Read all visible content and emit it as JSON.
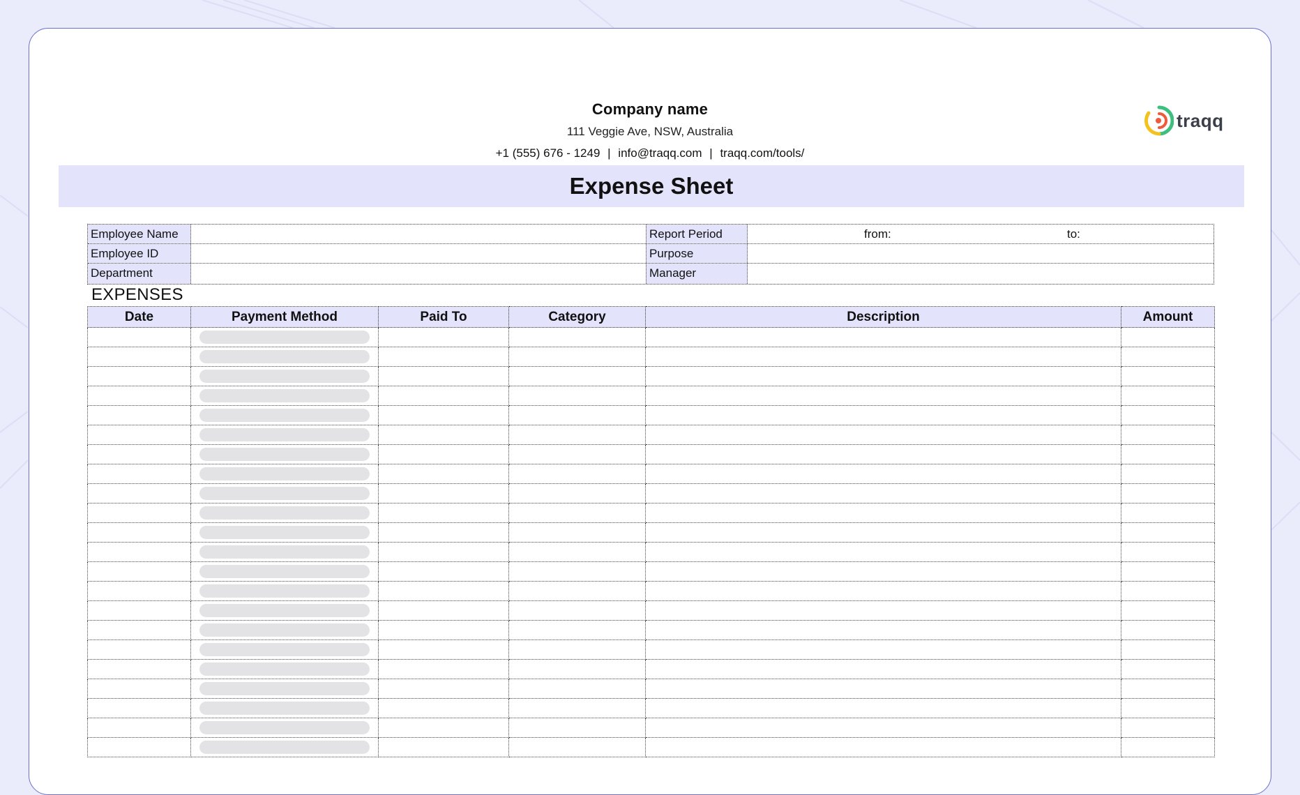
{
  "header": {
    "company_name": "Company name",
    "address": "111 Veggie Ave, NSW, Australia",
    "phone": "+1 (555) 676 - 1249",
    "email": "info@traqq.com",
    "website": "traqq.com/tools/",
    "separator": "|",
    "logo_text": "traqq",
    "logo_icon": "traqq-logo-icon"
  },
  "title": "Expense Sheet",
  "info": {
    "employee_name_label": "Employee Name",
    "employee_id_label": "Employee ID",
    "department_label": "Department",
    "report_period_label": "Report Period",
    "from_label": "from:",
    "to_label": "to:",
    "purpose_label": "Purpose",
    "manager_label": "Manager"
  },
  "expenses": {
    "section_title": "EXPENSES",
    "columns": [
      "Date",
      "Payment Method",
      "Paid To",
      "Category",
      "Description",
      "Amount"
    ],
    "row_count": 22
  },
  "colors": {
    "background": "#eaebfb",
    "accent_band": "#e3e4fb",
    "card_border": "#6a6fd0",
    "dropdown_pill": "#e3e3e6",
    "logo_yellow": "#f4c21f",
    "logo_red": "#ef5a3c",
    "logo_green": "#3fbf7f"
  }
}
